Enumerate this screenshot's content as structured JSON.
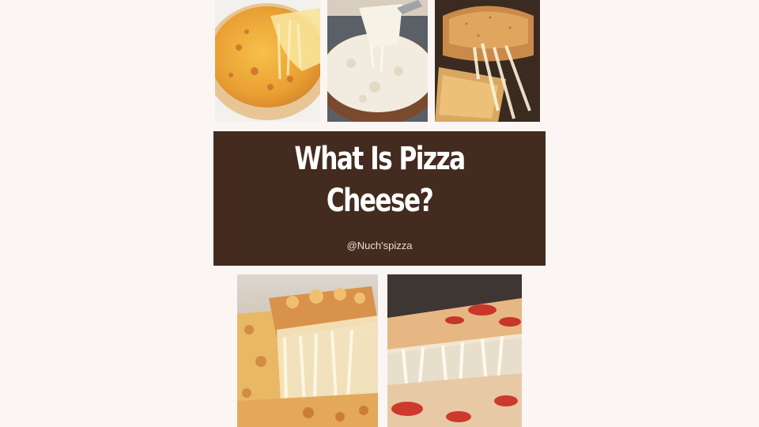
{
  "title": {
    "line1": "What Is Pizza",
    "line2": "Cheese?"
  },
  "handle": "@Nuch'spizza",
  "colors": {
    "background": "#fbf6f3",
    "title_box": "#432b1f",
    "title_text": "#ffffff"
  },
  "photos": [
    {
      "subject": "cheese pizza slice pull"
    },
    {
      "subject": "white cheese pizza with server"
    },
    {
      "subject": "garlic bread with stretchy cheese"
    },
    {
      "subject": "cheesy pizza slice with stretched cheese"
    },
    {
      "subject": "pepperoni pizza slice with stretched cheese"
    }
  ]
}
